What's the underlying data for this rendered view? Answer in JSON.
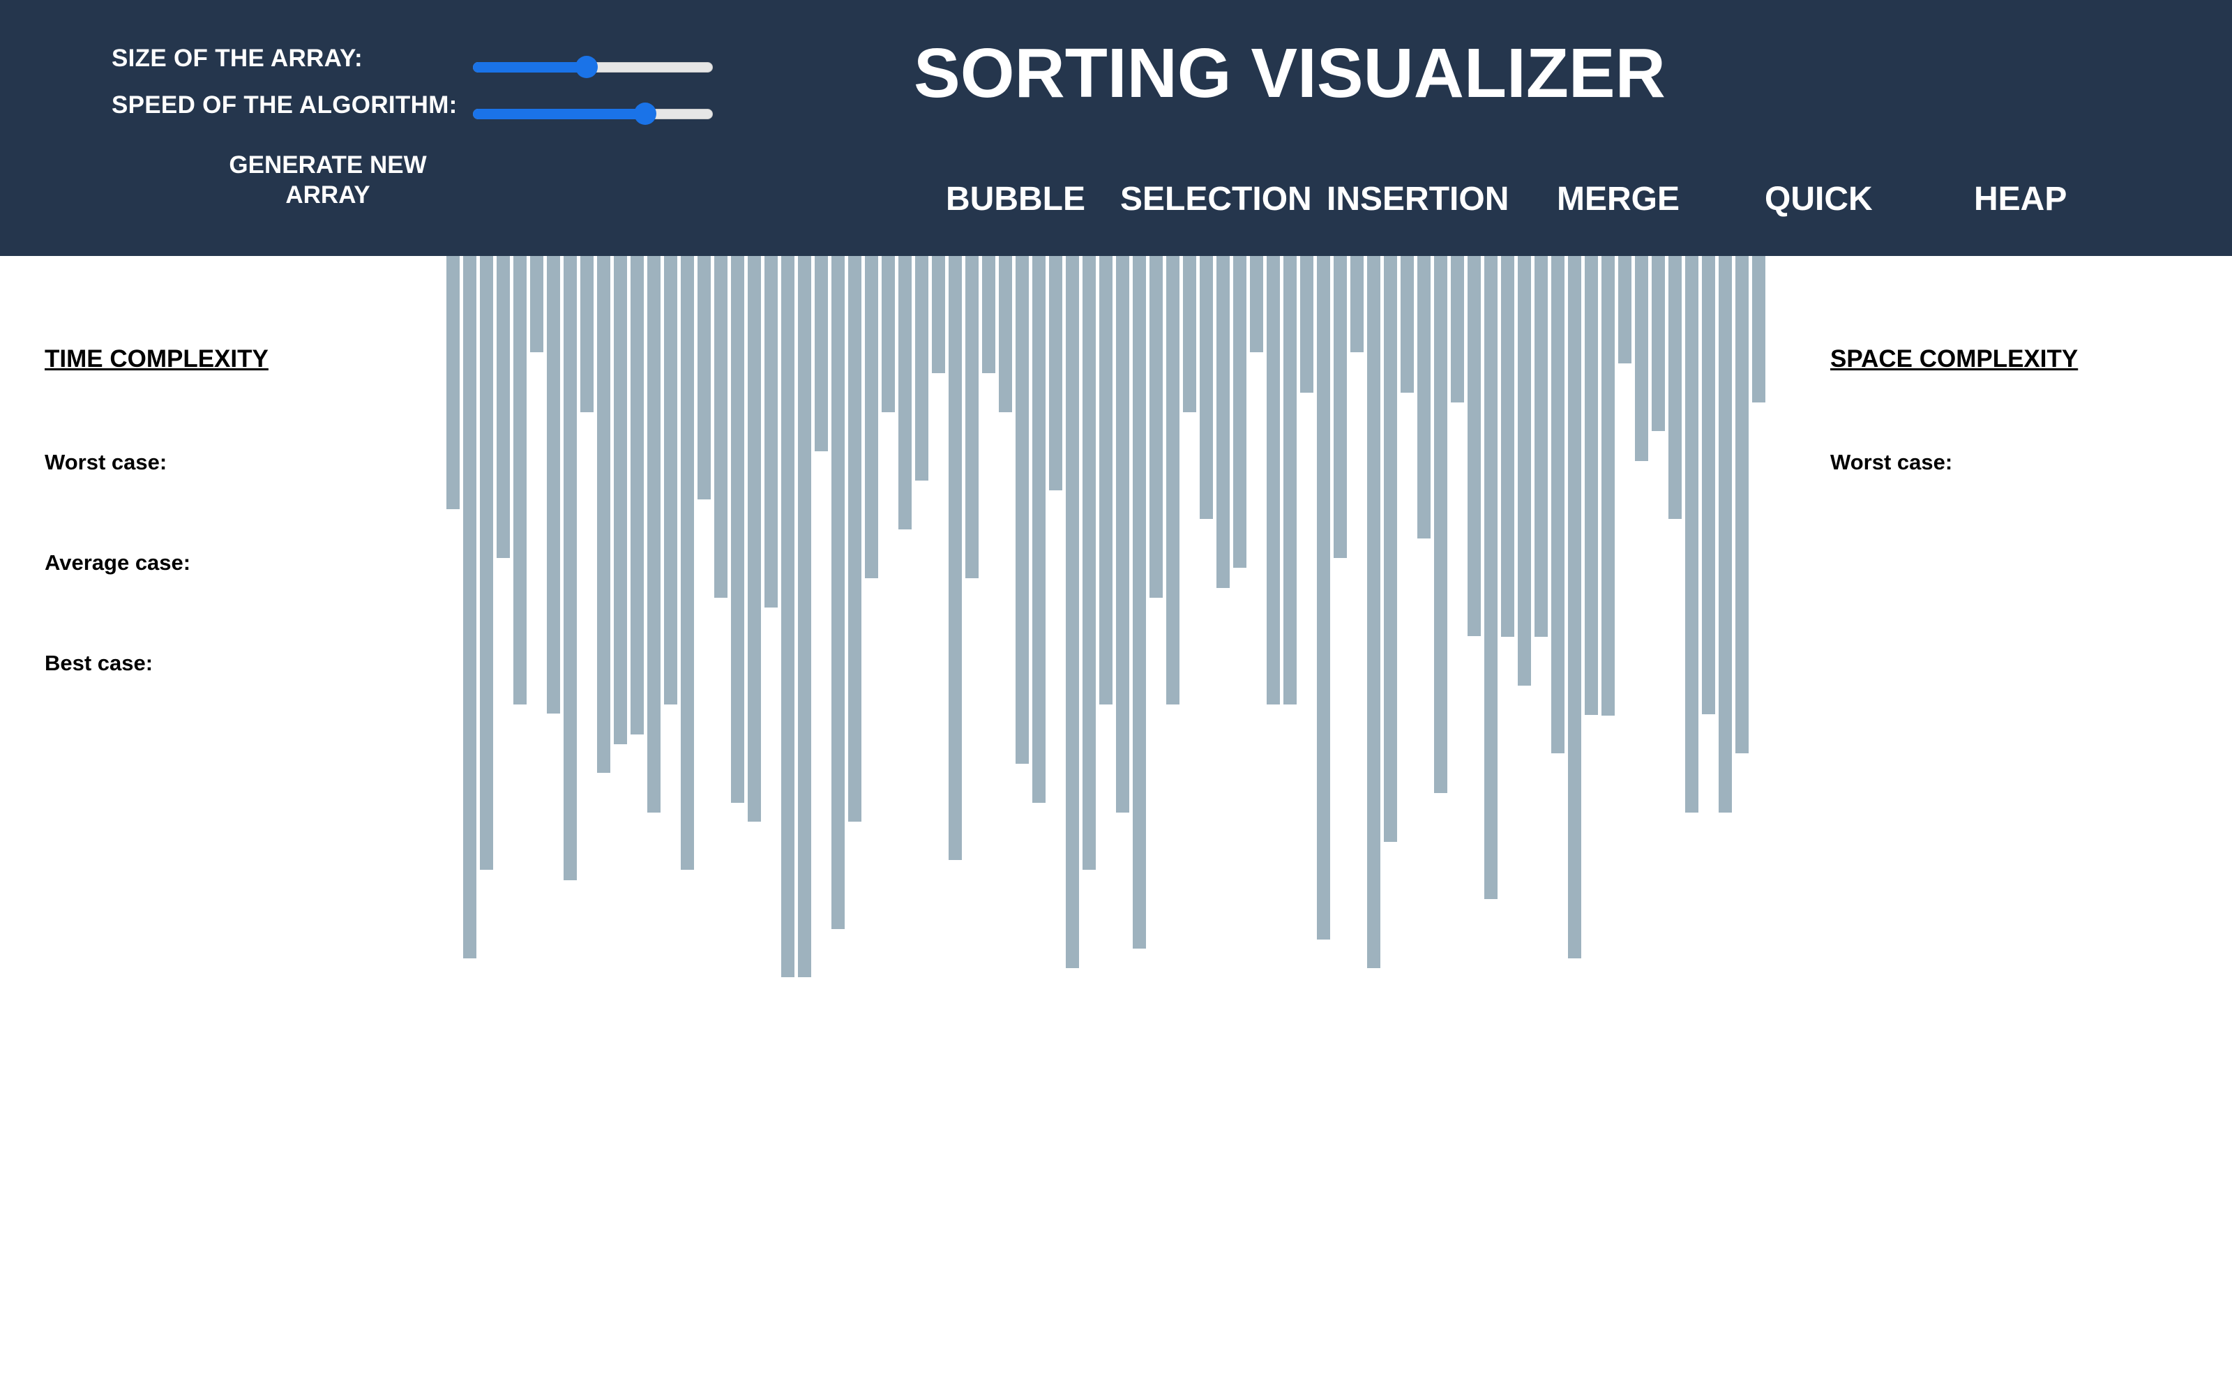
{
  "controls": {
    "size_label": "SIZE OF THE ARRAY:",
    "speed_label": "SPEED OF THE ALGORITHM:",
    "size_value": 0.47,
    "speed_value": 0.74,
    "generate_label_line1": "GENERATE NEW",
    "generate_label_line2": "ARRAY"
  },
  "header": {
    "title": "SORTING VISUALIZER"
  },
  "algorithms": {
    "bubble": "BUBBLE",
    "selection": "SELECTION",
    "insertion": "INSERTION",
    "merge": "MERGE",
    "quick": "QUICK",
    "heap": "HEAP"
  },
  "time_complexity": {
    "heading": "TIME COMPLEXITY",
    "worst": "Worst case:",
    "average": "Average case:",
    "best": "Best case:"
  },
  "space_complexity": {
    "heading": "SPACE COMPLEXITY",
    "worst": "Worst case:"
  },
  "array": {
    "bar_color": "#9eb2be",
    "values": [
      363,
      1007,
      880,
      433,
      643,
      138,
      656,
      895,
      224,
      741,
      700,
      686,
      798,
      643,
      880,
      349,
      490,
      784,
      811,
      504,
      1034,
      1034,
      280,
      965,
      811,
      462,
      224,
      392,
      322,
      168,
      866,
      462,
      168,
      224,
      728,
      784,
      336,
      1021,
      880,
      643,
      798,
      993,
      490,
      643,
      224,
      377,
      476,
      447,
      138,
      643,
      643,
      196,
      980,
      433,
      138,
      1021,
      840,
      196,
      405,
      770,
      210,
      545,
      922,
      546,
      616,
      546,
      713,
      1007,
      658,
      659,
      154,
      294,
      251,
      377,
      798,
      657,
      798,
      713,
      210
    ]
  },
  "colors": {
    "header_bg": "#25364d",
    "accent": "#1a73e8",
    "bar": "#9eb2be"
  }
}
